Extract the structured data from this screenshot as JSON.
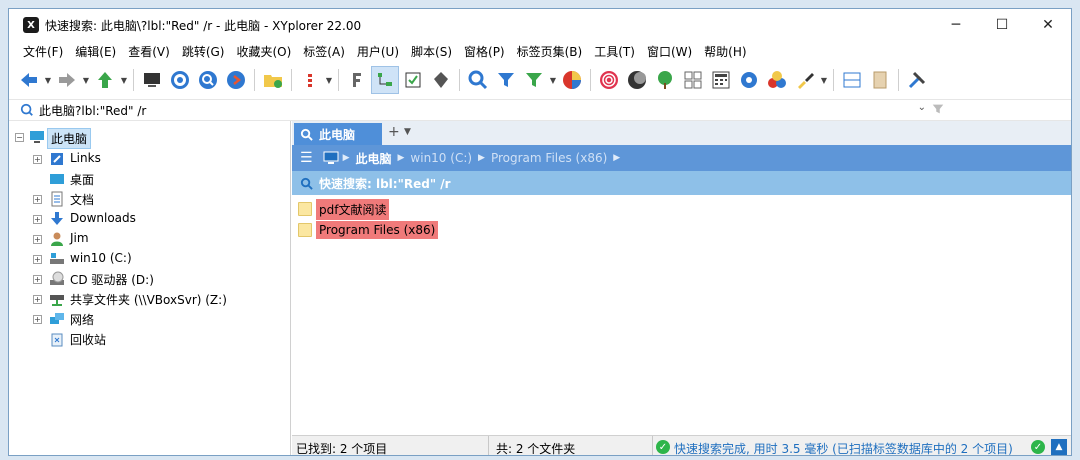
{
  "window": {
    "title": "快速搜索: 此电脑\\?lbl:\"Red\" /r - 此电脑 - XYplorer 22.00",
    "app_icon_text": "X",
    "controls": {
      "minimize": "─",
      "maximize": "☐",
      "close": "✕"
    }
  },
  "menu": [
    "文件(F)",
    "编辑(E)",
    "查看(V)",
    "跳转(G)",
    "收藏夹(O)",
    "标签(A)",
    "用户(U)",
    "脚本(S)",
    "窗格(P)",
    "标签页集(B)",
    "工具(T)",
    "窗口(W)",
    "帮助(H)"
  ],
  "address": {
    "text": "此电脑?lbl:\"Red\" /r",
    "dropdown": "⌄"
  },
  "tree": {
    "root": "此电脑",
    "items": [
      "Links",
      "桌面",
      "文档",
      "Downloads",
      "Jim",
      "win10 (C:)",
      "CD 驱动器 (D:)",
      "共享文件夹 (\\\\VBoxSvr) (Z:)",
      "网络",
      "回收站"
    ]
  },
  "tab": {
    "label": "此电脑",
    "add": "+",
    "menu": "▼"
  },
  "breadcrumb": {
    "items": [
      "此电脑",
      "win10 (C:)",
      "Program Files (x86)"
    ]
  },
  "quick_search": {
    "label": "快速搜索: lbl:\"Red\" /r"
  },
  "files": [
    "pdf文献阅读",
    "Program Files (x86)"
  ],
  "status": {
    "found": "已找到:  2 个项目",
    "total": "共: 2 个文件夹",
    "message": "快速搜索完成, 用时 3.5 毫秒 (已扫描标签数据库中的 2 个项目)"
  },
  "colors": {
    "accent": "#4f8fd9",
    "label_red": "#f07a7a",
    "qs_bar": "#8ec0e8"
  },
  "toolbar_icons": [
    "back-arrow-icon",
    "forward-arrow-icon",
    "up-arrow-icon",
    "computer-icon",
    "target-icon",
    "find-icon",
    "next-icon",
    "new-folder-icon",
    "list-icon",
    "format-icon",
    "tree-toggle-icon",
    "checkbox-icon",
    "tag-icon",
    "search-icon",
    "filter-icon",
    "visual-filter-icon",
    "pie-icon",
    "spiral-icon",
    "moon-icon",
    "tree-icon",
    "grid-icon",
    "calculator-icon",
    "gear-icon",
    "color-balls-icon",
    "brush-icon",
    "layout-icon",
    "panel-icon",
    "tools-icon"
  ]
}
